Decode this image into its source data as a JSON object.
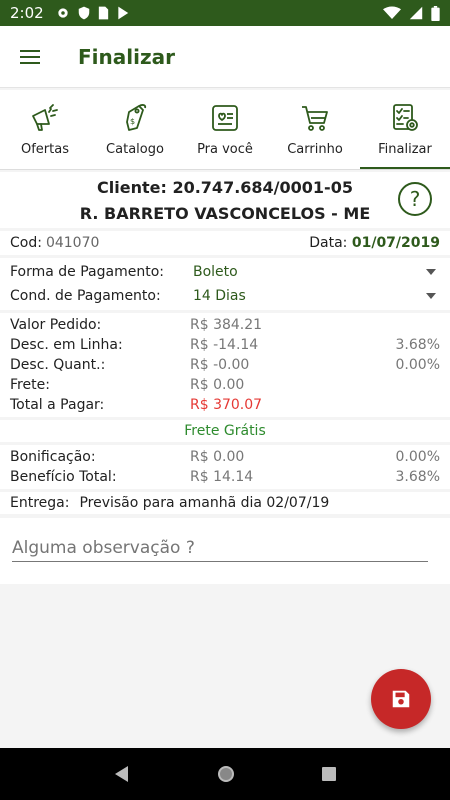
{
  "status_bar": {
    "time": "2:02",
    "icons": [
      "settings-icon",
      "shield-icon",
      "sim-icon",
      "play-store-icon",
      "wifi-icon",
      "signal-icon",
      "battery-icon"
    ]
  },
  "app_bar": {
    "title": "Finalizar",
    "menu_icon": "hamburger-icon"
  },
  "tabs": [
    {
      "label": "Ofertas",
      "icon": "megaphone-icon"
    },
    {
      "label": "Catalogo",
      "icon": "price-tag-icon"
    },
    {
      "label": "Pra você",
      "icon": "profile-card-icon"
    },
    {
      "label": "Carrinho",
      "icon": "cart-icon"
    },
    {
      "label": "Finalizar",
      "icon": "checklist-gear-icon",
      "active": true
    }
  ],
  "client": {
    "line1": "Cliente: 20.747.684/0001-05",
    "line2": "R. BARRETO VASCONCELOS - ME",
    "help_icon": "help-circle-icon",
    "help_glyph": "?"
  },
  "order": {
    "cod_label": "Cod:",
    "cod_value": "041070",
    "date_label": "Data:",
    "date_value": "01/07/2019"
  },
  "payment": {
    "form_label": "Forma de Pagamento:",
    "form_value": "Boleto",
    "cond_label": "Cond. de Pagamento:",
    "cond_value": "14 Dias"
  },
  "values": [
    {
      "label": "Valor Pedido:",
      "amount": "R$ 384.21",
      "pct": ""
    },
    {
      "label": "Desc. em Linha:",
      "amount": "R$ -14.14",
      "pct": "3.68%"
    },
    {
      "label": "Desc. Quant.:",
      "amount": "R$ -0.00",
      "pct": "0.00%"
    },
    {
      "label": "Frete:",
      "amount": "R$ 0.00",
      "pct": ""
    },
    {
      "label": "Total a Pagar:",
      "amount": "R$ 370.07",
      "pct": ""
    }
  ],
  "frete_banner": "Frete Grátis",
  "bonus": [
    {
      "label": "Bonificação:",
      "amount": "R$ 0.00",
      "pct": "0.00%"
    },
    {
      "label": "Benefício Total:",
      "amount": "R$ 14.14",
      "pct": "3.68%"
    }
  ],
  "delivery": {
    "label": "Entrega:",
    "value": "Previsão para amanhã dia 02/07/19"
  },
  "observation": {
    "placeholder": "Alguma observação ?"
  },
  "fab": {
    "icon": "save-icon"
  },
  "colors": {
    "primary": "#2e5a1c",
    "accent_red": "#c62828",
    "total_red": "#e53935",
    "frete_green": "#2e8b2e"
  }
}
